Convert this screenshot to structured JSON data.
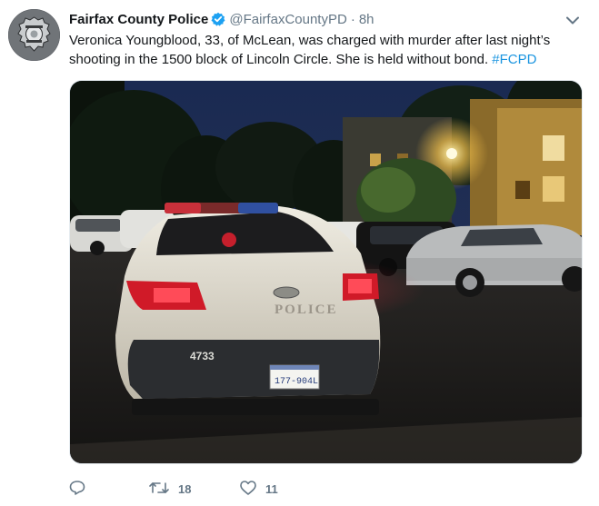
{
  "tweet": {
    "author": {
      "display_name": "Fairfax County Police",
      "handle": "@FairfaxCountyPD",
      "verified": true,
      "avatar_icon": "police-badge-icon"
    },
    "time": "8h",
    "text_main": "Veronica Youngblood, 33, of McLean, was charged with murder after last night’s shooting in the 1500 block of Lincoln Circle. She is held without bond. ",
    "hashtag": "#FCPD",
    "media": {
      "description_icon": "police-car-night-photo",
      "car_lettering": "POLICE",
      "unit_number": "4733",
      "license_plate": "177-904L"
    },
    "actions": {
      "reply_icon": "reply-icon",
      "retweet_icon": "retweet-icon",
      "retweet_count": "18",
      "like_icon": "heart-icon",
      "like_count": "11"
    },
    "colors": {
      "link": "#1b95e0",
      "secondary_text": "#657786",
      "verified": "#1da1f2"
    }
  }
}
